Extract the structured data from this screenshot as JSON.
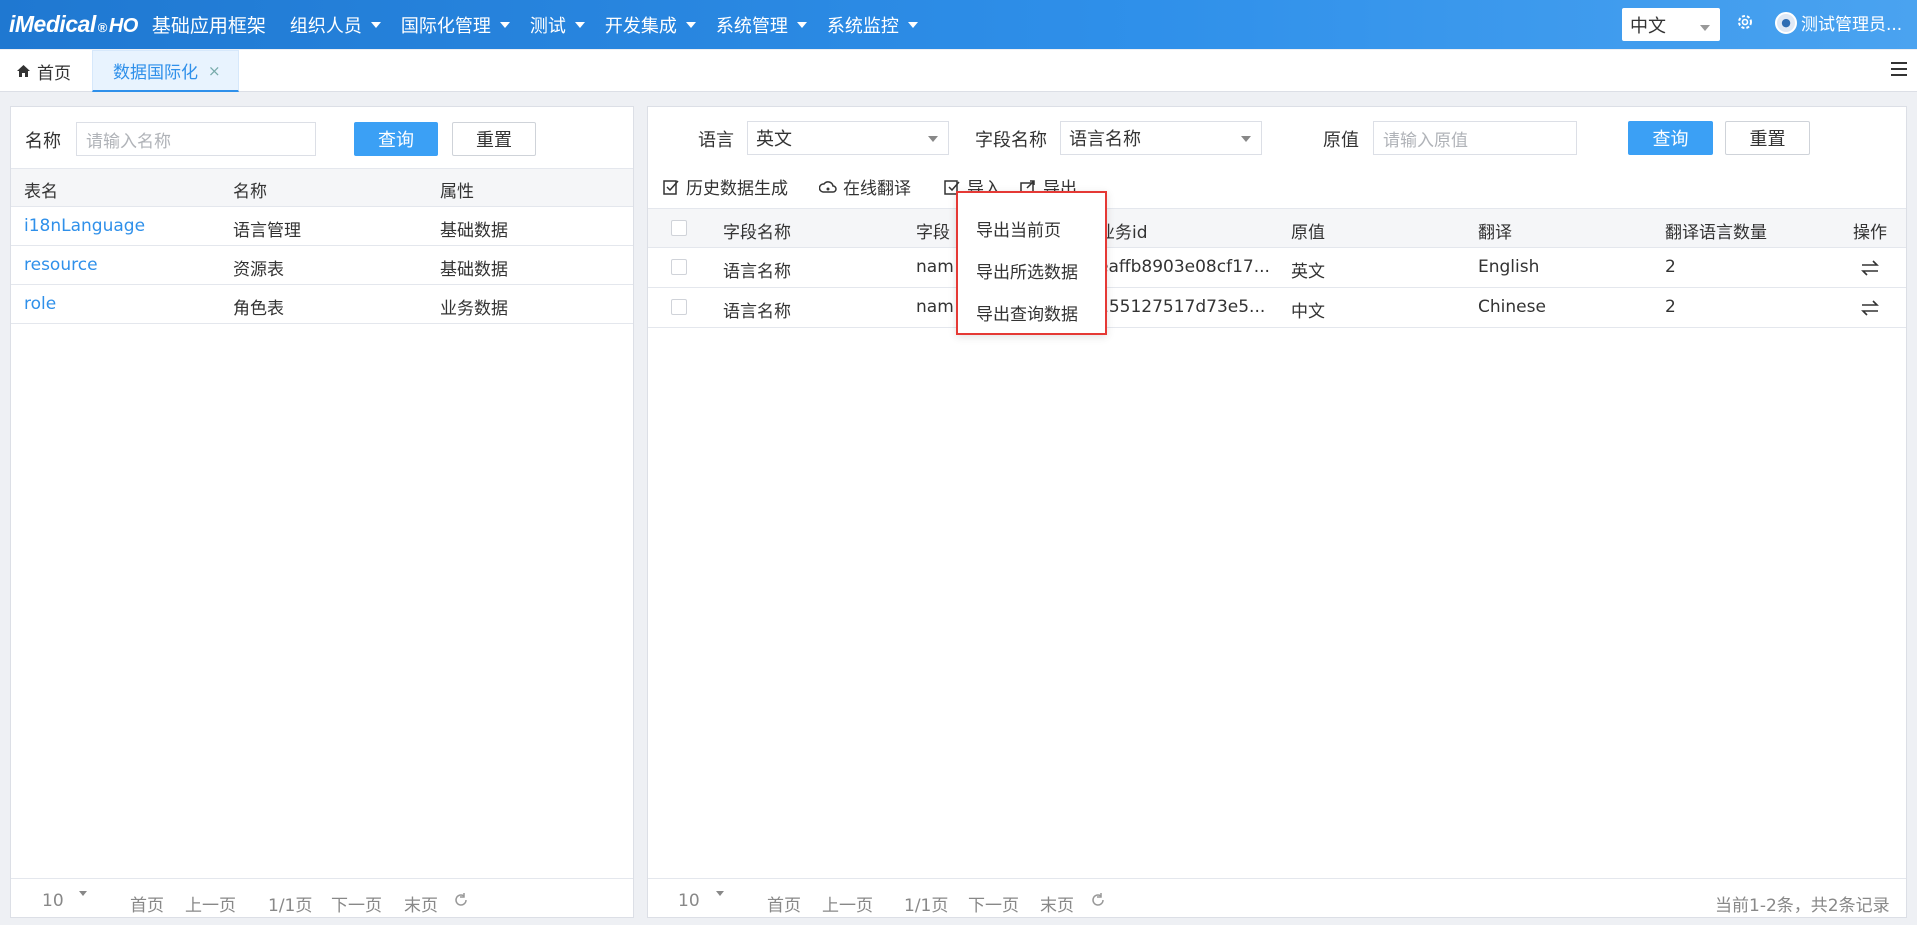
{
  "header": {
    "brand_main": "iMedical",
    "brand_reg": "®",
    "brand_suffix": "HO",
    "app_title": "基础应用框架",
    "nav": [
      "组织人员",
      "国际化管理",
      "测试",
      "开发集成",
      "系统管理",
      "系统监控"
    ],
    "language": "中文",
    "user": "测试管理员..."
  },
  "tabs": {
    "home": "首页",
    "active": "数据国际化",
    "close": "×"
  },
  "left": {
    "name_label": "名称",
    "name_placeholder": "请输入名称",
    "query_btn": "查询",
    "reset_btn": "重置",
    "columns": [
      "表名",
      "名称",
      "属性"
    ],
    "rows": [
      [
        "i18nLanguage",
        "语言管理",
        "基础数据"
      ],
      [
        "resource",
        "资源表",
        "基础数据"
      ],
      [
        "role",
        "角色表",
        "业务数据"
      ]
    ],
    "pager": {
      "size": "10",
      "first": "首页",
      "prev": "上一页",
      "page": "1/1页",
      "next": "下一页",
      "last": "末页"
    }
  },
  "right": {
    "lang_label": "语言",
    "lang_value": "英文",
    "field_label": "字段名称",
    "field_value": "语言名称",
    "orig_label": "原值",
    "orig_placeholder": "请输入原值",
    "query_btn": "查询",
    "reset_btn": "重置",
    "toolbar": {
      "history": "历史数据生成",
      "online": "在线翻译",
      "import": "导入",
      "export": "导出"
    },
    "columns": [
      "字段名称",
      "字段",
      "业务id",
      "原值",
      "翻译",
      "翻译语言数量",
      "操作"
    ],
    "rows": [
      [
        "语言名称",
        "nam",
        "eaffb8903e08cf17...",
        "英文",
        "English",
        "2"
      ],
      [
        "语言名称",
        "nam",
        "155127517d73e5...",
        "中文",
        "Chinese",
        "2"
      ]
    ],
    "pager": {
      "size": "10",
      "first": "首页",
      "prev": "上一页",
      "page": "1/1页",
      "next": "下一页",
      "last": "末页",
      "summary": "当前1-2条，共2条记录"
    }
  },
  "export_menu": [
    "导出当前页",
    "导出所选数据",
    "导出查询数据"
  ],
  "colors": {
    "header": "#2f90ea",
    "primary": "#3ba0f5",
    "link": "#2f90ea",
    "highlight": "#e53935"
  },
  "icons": [
    "home-icon",
    "gear-icon",
    "menu-icon",
    "history-icon",
    "cloud-translate-icon",
    "import-icon",
    "export-icon",
    "swap-icon",
    "refresh-icon"
  ]
}
